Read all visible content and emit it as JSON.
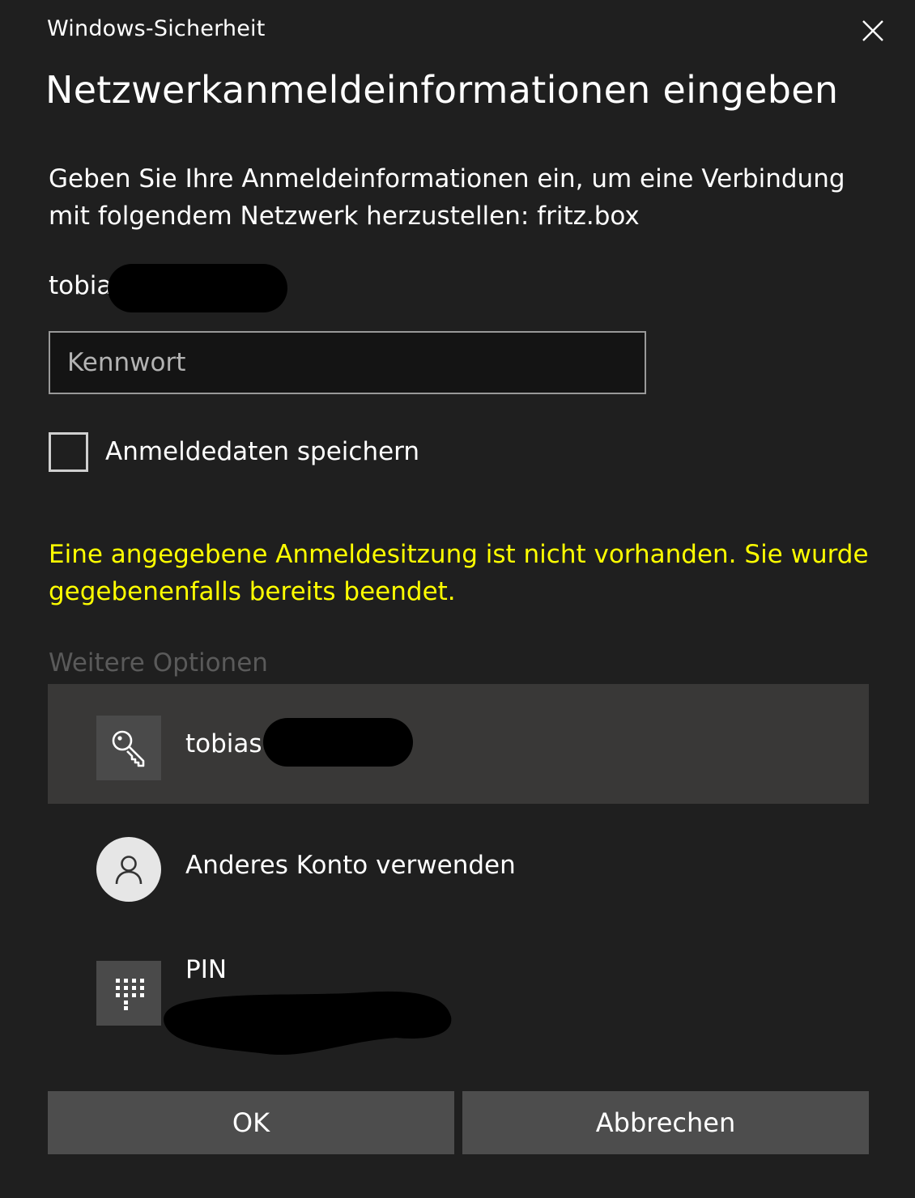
{
  "window": {
    "title": "Windows-Sicherheit",
    "close_icon": "close-icon"
  },
  "heading": "Netzwerkanmeldeinformationen eingeben",
  "description": "Geben Sie Ihre Anmeldeinformationen ein, um eine Verbindung mit folgendem Netzwerk herzustellen: fritz.box",
  "username": "tobia",
  "password": {
    "value": "",
    "placeholder": "Kennwort"
  },
  "remember": {
    "label": "Anmeldedaten speichern",
    "checked": false
  },
  "error_message": "Eine angegebene Anmeldesitzung ist nicht vorhanden. Sie wurde gegebenenfalls bereits beendet.",
  "more_options": {
    "label": "Weitere Optionen",
    "items": [
      {
        "label": "tobias",
        "icon": "key-icon",
        "selected": true
      },
      {
        "label": "Anderes Konto verwenden",
        "icon": "user-icon",
        "selected": false
      },
      {
        "label": "PIN",
        "icon": "pin-keypad-icon",
        "selected": false
      }
    ]
  },
  "buttons": {
    "ok": "OK",
    "cancel": "Abbrechen"
  },
  "colors": {
    "background": "#1f1f1f",
    "error": "#ffff00",
    "selected_option": "#393837",
    "button": "#4d4d4d"
  }
}
